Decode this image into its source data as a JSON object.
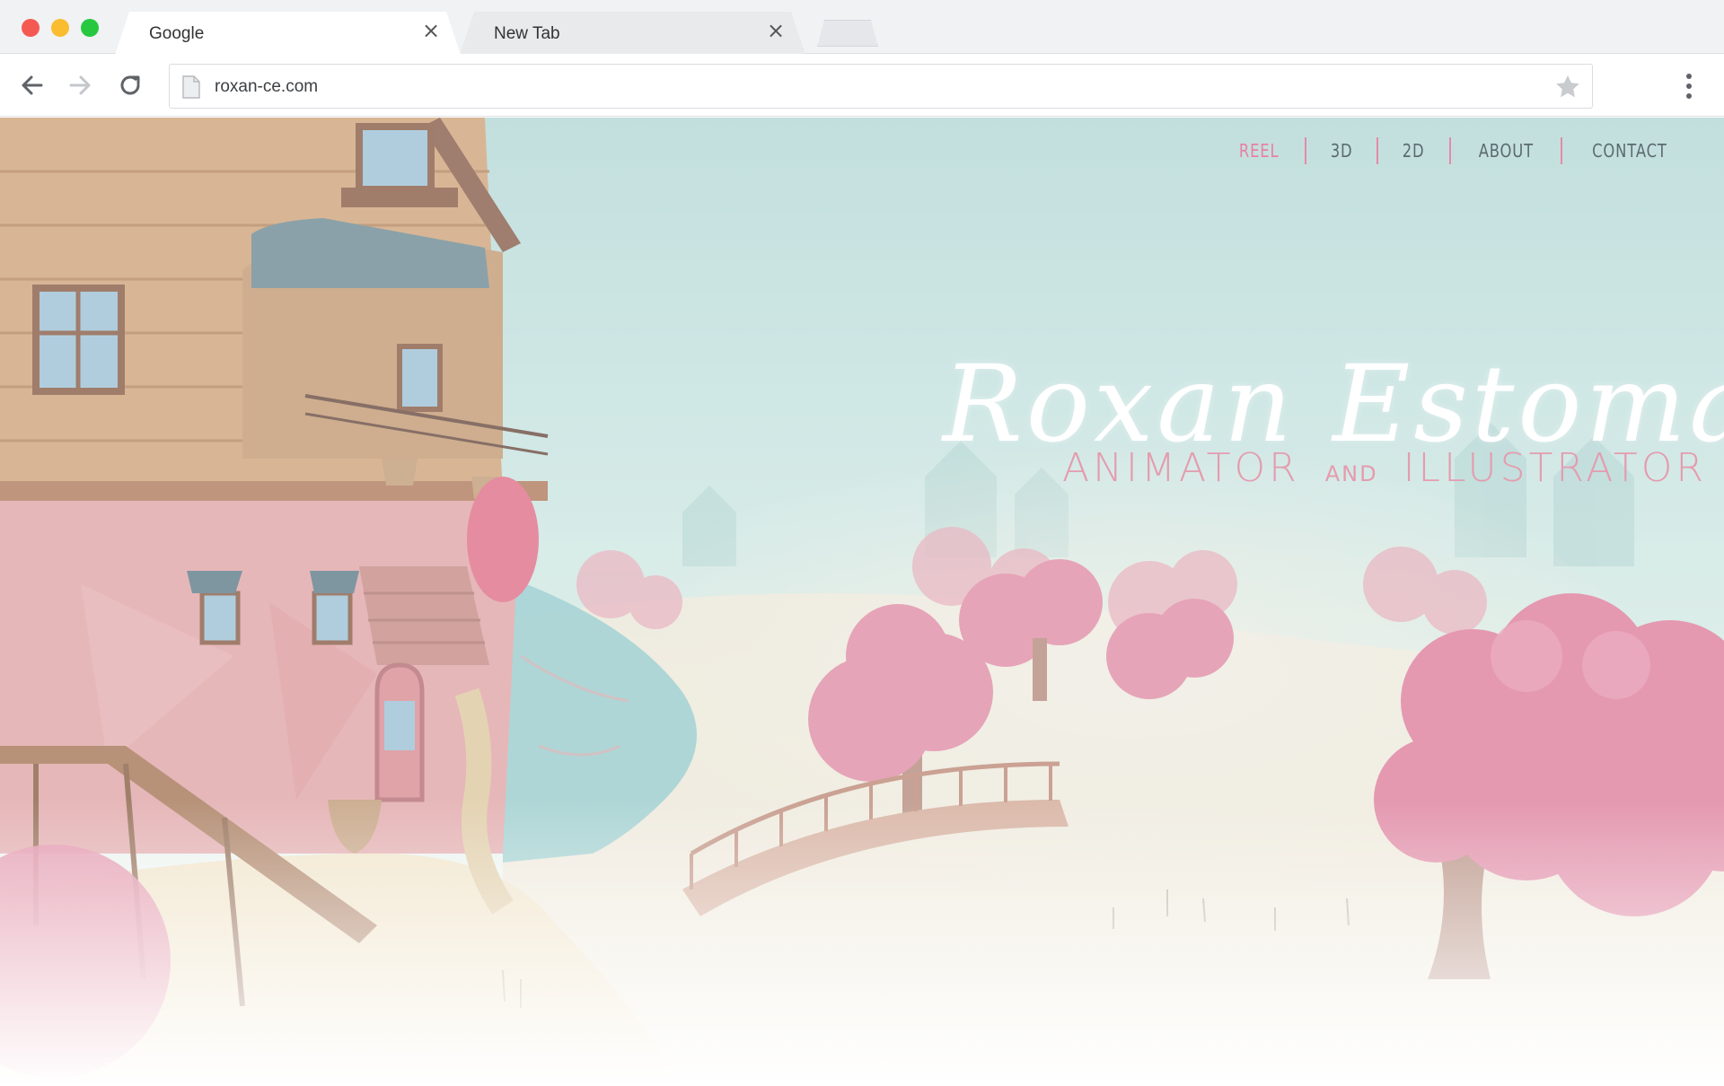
{
  "browser": {
    "tabs": [
      {
        "title": "Google",
        "active": true
      },
      {
        "title": "New Tab",
        "active": false
      }
    ],
    "address": "roxan-ce.com"
  },
  "site": {
    "nav": [
      {
        "label": "REEL",
        "active": true
      },
      {
        "label": "3D",
        "active": false
      },
      {
        "label": "2D",
        "active": false
      },
      {
        "label": "ABOUT",
        "active": false
      },
      {
        "label": "CONTACT",
        "active": false
      }
    ],
    "hero": {
      "name": "Roxan Estomata",
      "role_part1": "ANIMATOR",
      "conjunction": "AND",
      "role_part2": "ILLUSTRATOR"
    }
  },
  "colors": {
    "nav_active": "#e97fa2",
    "nav_text": "#5b6a6e",
    "subtitle": "#e49cae",
    "sky": "#b7d9d7",
    "tree_pink": "#e48aa3"
  },
  "icons": [
    "close-icon",
    "back-arrow-icon",
    "forward-arrow-icon",
    "reload-icon",
    "page-icon",
    "star-icon",
    "menu-dots-icon"
  ]
}
